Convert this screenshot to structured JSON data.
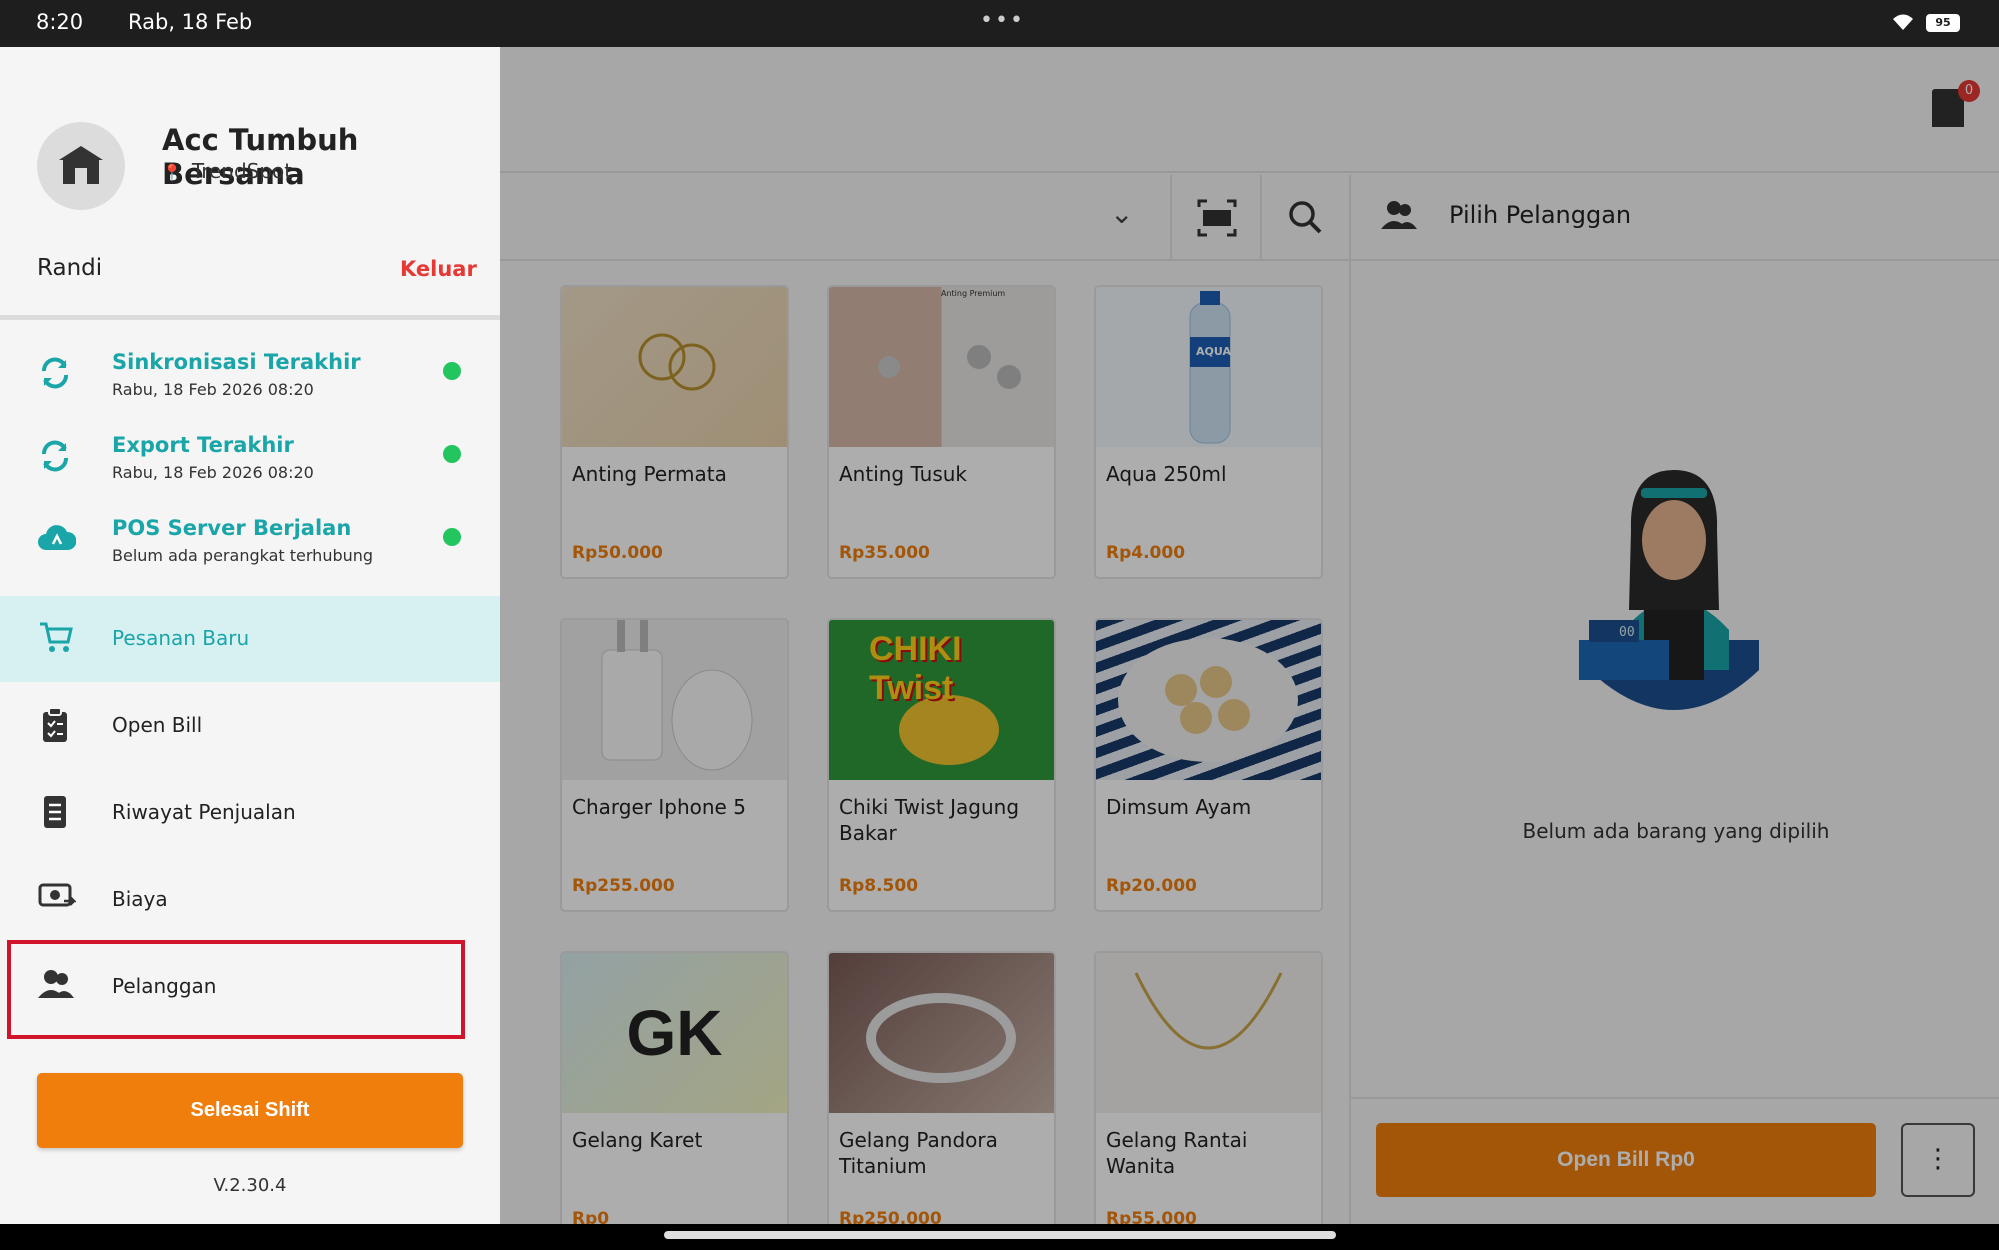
{
  "status_bar": {
    "time": "8:20",
    "date": "Rab, 18 Feb",
    "battery": "95"
  },
  "header": {
    "bill_count": "0"
  },
  "customer": {
    "label": "Pilih Pelanggan"
  },
  "cart": {
    "empty_text": "Belum ada barang yang dipilih",
    "open_bill_label": "Open Bill Rp0",
    "register_display": "00"
  },
  "products": [
    {
      "name": "Anting Permata",
      "price": "Rp50.000"
    },
    {
      "name": "Anting Tusuk",
      "price": "Rp35.000",
      "thumb_text": "Anting Premium"
    },
    {
      "name": "Aqua 250ml",
      "price": "Rp4.000",
      "thumb_text": "AQUA"
    },
    {
      "name": "Charger Iphone 5",
      "price": "Rp255.000"
    },
    {
      "name": "Chiki Twist Jagung Bakar",
      "price": "Rp8.500",
      "thumb_text": "CHIKI Twist"
    },
    {
      "name": "Dimsum Ayam",
      "price": "Rp20.000"
    },
    {
      "name": "Gelang Karet",
      "price": "Rp0",
      "thumb_text": "GK"
    },
    {
      "name": "Gelang Pandora Titanium",
      "price": "Rp250.000"
    },
    {
      "name": "Gelang Rantai Wanita",
      "price": "Rp55.000"
    }
  ],
  "drawer": {
    "store_name": "Acc Tumbuh Bersama",
    "store_location": "TrendSpot",
    "user_name": "Randi",
    "logout_label": "Keluar",
    "status_items": [
      {
        "title": "Sinkronisasi Terakhir",
        "subtitle": "Rabu, 18 Feb 2026 08:20"
      },
      {
        "title": "Export Terakhir",
        "subtitle": "Rabu, 18 Feb 2026 08:20"
      },
      {
        "title": "POS Server Berjalan",
        "subtitle": "Belum ada perangkat terhubung"
      }
    ],
    "menu": [
      {
        "label": "Pesanan Baru"
      },
      {
        "label": "Open Bill"
      },
      {
        "label": "Riwayat Penjualan"
      },
      {
        "label": "Biaya"
      },
      {
        "label": "Pelanggan"
      }
    ],
    "end_shift_label": "Selesai Shift",
    "version": "V.2.30.4"
  },
  "colors": {
    "accent": "#1aa5a8",
    "primary_button": "#f07e0c",
    "logout": "#e53935",
    "status_ok": "#22c55e",
    "highlight": "#d0152b"
  }
}
